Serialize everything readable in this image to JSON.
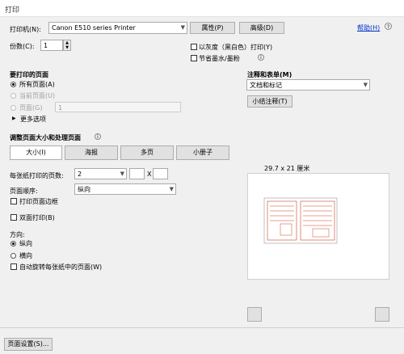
{
  "window": {
    "title": "打印"
  },
  "printer": {
    "label": "打印机(N):",
    "selected": "Canon E510 series Printer",
    "properties_button": "属性(P)",
    "advanced_button": "高级(D)",
    "help_link": "帮助(H)"
  },
  "copies": {
    "label": "份数(C):",
    "value": "1"
  },
  "options": {
    "grayscale": "以灰度（黑白色）打印(Y)",
    "save_ink": "节省墨水/墨粉"
  },
  "pages_to_print": {
    "heading": "要打印的页面",
    "all": "所有页面(A)",
    "current": "当前页面(U)",
    "pages": "页面(G)",
    "pages_value": "1",
    "more": "更多选项"
  },
  "comments": {
    "heading": "注释和表单(M)",
    "selected": "文档和标记",
    "summarize_button": "小结注释(T)"
  },
  "sizing": {
    "heading": "调整页面大小和处理页面",
    "tabs": [
      "大小(I)",
      "海报",
      "多页",
      "小册子"
    ],
    "pages_per_sheet_label": "每张纸打印的页数:",
    "pages_per_sheet_value": "2",
    "x_label": "X",
    "order_label": "页面顺序:",
    "order_value": "纵向",
    "print_border": "打印页面边框"
  },
  "duplex": {
    "label": "双面打印(B)"
  },
  "orientation": {
    "heading": "方向:",
    "portrait": "纵向",
    "landscape": "横向",
    "auto_rotate": "自动旋转每张纸中的页面(W)"
  },
  "preview": {
    "size_label": "29.7 x 21 厘米"
  },
  "footer": {
    "page_setup_button": "页面设置(S)..."
  }
}
